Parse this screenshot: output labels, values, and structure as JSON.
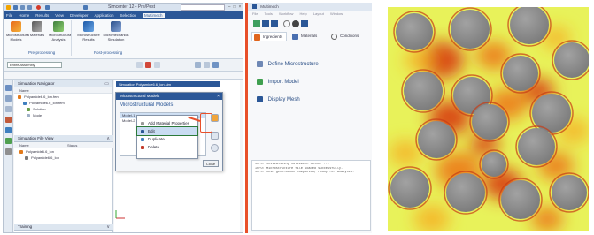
{
  "nx": {
    "title_text": "Simcenter 12 - Pre/Post",
    "menu": [
      "File",
      "Home",
      "Results",
      "View",
      "Developer",
      "Application",
      "Selection",
      "Multimech"
    ],
    "active_menu_index": 7,
    "ribbon": {
      "buttons": [
        "Microstructural Models",
        "Materials",
        "Microstructural Analysis",
        "Microstructure Results",
        "Micromechanics Simulation"
      ],
      "groups": [
        "Pre-processing",
        "Post-processing"
      ]
    },
    "selection_filter": "Entire Assembly",
    "navigator": {
      "title": "Simulation Navigator",
      "column": "Name",
      "rows": [
        "Polyamide6.6_lon.fem",
        "Polyamide6.6_lon.fem",
        "Solution",
        "Model"
      ]
    },
    "sim_file_view": {
      "title": "Simulation File View",
      "columns": [
        "Name",
        "Status"
      ],
      "rows": [
        "Polyamide6.6_lon",
        "Polyamide6.6_lon"
      ]
    },
    "bottom_panel_label": "Training",
    "workspace_tab": "Simulation Polyamide6.6_lon.sim",
    "dialog": {
      "title": "Microstructural Models",
      "section": "Microstructural Models",
      "models": [
        "Model-1",
        "Model-2"
      ],
      "close_label": "Close"
    },
    "context_menu": {
      "items": [
        "Add Material Properties",
        "Edit",
        "Duplicate",
        "Delete"
      ],
      "highlight_index": 1
    }
  },
  "middle_panel": {
    "title": "Multimech",
    "menu": [
      "File",
      "Tools",
      "Workflow",
      "Help",
      "Layout",
      "Window"
    ],
    "tabs": [
      "Ingredients",
      "Materials",
      "Conditions"
    ],
    "steps": [
      "Define Microstructure",
      "Import Model",
      "Display Mesh"
    ],
    "log_lines": [
      "INFO: Initializing Multimech solver ...",
      "INFO: Microstructure file loaded successfully.",
      "INFO: Mesh generation completed, ready for analysis."
    ]
  },
  "heatmap": {
    "fiber_count": 16,
    "fiber_color": "#8a8a8a",
    "colormap": [
      "#d83a12",
      "#ec7a18",
      "#f5b52a",
      "#f6e84a",
      "#e8f25a"
    ]
  },
  "colors": {
    "accent": "#2b5797",
    "highlight_red": "#e8502a",
    "active_green": "#2c7a3a"
  }
}
